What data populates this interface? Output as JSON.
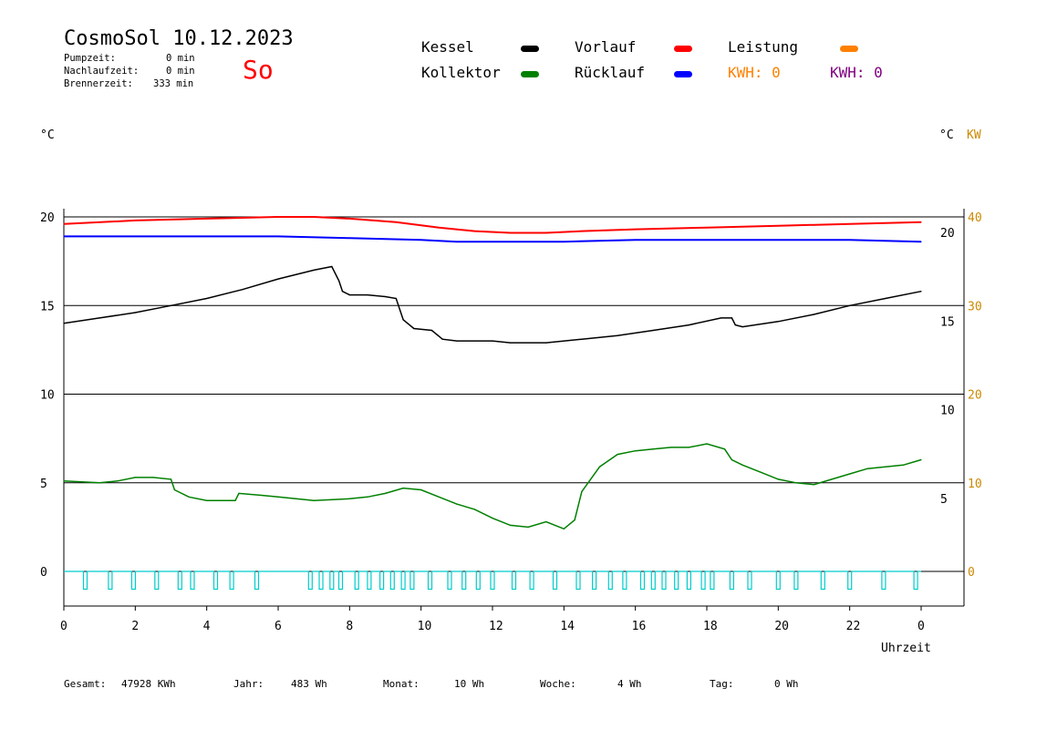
{
  "header": {
    "title": "CosmoSol 10.12.2023",
    "weekday": "So",
    "stats": [
      {
        "label": "Pumpzeit:",
        "value": "0 min"
      },
      {
        "label": "Nachlaufzeit:",
        "value": "0 min"
      },
      {
        "label": "Brennerzeit:",
        "value": "333 min"
      }
    ]
  },
  "legend": {
    "kessel": {
      "label": "Kessel",
      "color": "#000000"
    },
    "vorlauf": {
      "label": "Vorlauf",
      "color": "#ff0000"
    },
    "leistung": {
      "label": "Leistung",
      "color": "#ff8000"
    },
    "kollektor": {
      "label": "Kollektor",
      "color": "#008000"
    },
    "ruecklauf": {
      "label": "Rücklauf",
      "color": "#0000ff"
    },
    "kwh_orange": "KWH: 0",
    "kwh_purple": "KWH: 0",
    "kwh_orange_color": "#ff8000",
    "kwh_purple_color": "#800080"
  },
  "units": {
    "left": "°C",
    "right": "°C",
    "right_power": "KW"
  },
  "footer": [
    {
      "label": "Gesamt:",
      "value": "47928 KWh"
    },
    {
      "label": "Jahr:",
      "value": "483 Wh"
    },
    {
      "label": "Monat:",
      "value": "10 Wh"
    },
    {
      "label": "Woche:",
      "value": "4 Wh"
    },
    {
      "label": "Tag:",
      "value": "0 Wh"
    }
  ],
  "chart_data": {
    "type": "line",
    "xlabel": "Uhrzeit",
    "x_ticks": [
      "0",
      "2",
      "4",
      "6",
      "8",
      "10",
      "12",
      "14",
      "16",
      "18",
      "20",
      "22",
      "0"
    ],
    "xlim": [
      0,
      24
    ],
    "y_left_ticks": [
      "20",
      "15",
      "10",
      "5",
      "0"
    ],
    "y_right_inner_ticks": [
      "20",
      "15",
      "10",
      "5"
    ],
    "y_right_power_ticks": [
      "40",
      "30",
      "20",
      "10",
      "0"
    ],
    "ylim": [
      0,
      20
    ],
    "grid": "horizontal",
    "series": [
      {
        "name": "Vorlauf",
        "color": "#ff0000",
        "points": [
          [
            0,
            19.6
          ],
          [
            2,
            19.8
          ],
          [
            4,
            19.9
          ],
          [
            6,
            20.0
          ],
          [
            7,
            20.0
          ],
          [
            8,
            19.9
          ],
          [
            9.3,
            19.7
          ],
          [
            10.5,
            19.4
          ],
          [
            11.5,
            19.2
          ],
          [
            12.5,
            19.1
          ],
          [
            13.5,
            19.1
          ],
          [
            14.5,
            19.2
          ],
          [
            16,
            19.3
          ],
          [
            18,
            19.4
          ],
          [
            20,
            19.5
          ],
          [
            22,
            19.6
          ],
          [
            24,
            19.7
          ]
        ]
      },
      {
        "name": "Rücklauf",
        "color": "#0000ff",
        "points": [
          [
            0,
            18.9
          ],
          [
            2,
            18.9
          ],
          [
            4,
            18.9
          ],
          [
            6,
            18.9
          ],
          [
            8,
            18.8
          ],
          [
            10,
            18.7
          ],
          [
            11,
            18.6
          ],
          [
            12,
            18.6
          ],
          [
            13,
            18.6
          ],
          [
            14,
            18.6
          ],
          [
            16,
            18.7
          ],
          [
            18,
            18.7
          ],
          [
            20,
            18.7
          ],
          [
            22,
            18.7
          ],
          [
            24,
            18.6
          ]
        ]
      },
      {
        "name": "Kessel",
        "color": "#000000",
        "points": [
          [
            0,
            14.0
          ],
          [
            1,
            14.3
          ],
          [
            2,
            14.6
          ],
          [
            3,
            15.0
          ],
          [
            4,
            15.4
          ],
          [
            5,
            15.9
          ],
          [
            6,
            16.5
          ],
          [
            7,
            17.0
          ],
          [
            7.5,
            17.2
          ],
          [
            7.7,
            16.4
          ],
          [
            7.8,
            15.8
          ],
          [
            8,
            15.6
          ],
          [
            8.5,
            15.6
          ],
          [
            9,
            15.5
          ],
          [
            9.3,
            15.4
          ],
          [
            9.5,
            14.2
          ],
          [
            9.8,
            13.7
          ],
          [
            10.3,
            13.6
          ],
          [
            10.6,
            13.1
          ],
          [
            11,
            13.0
          ],
          [
            12,
            13.0
          ],
          [
            12.5,
            12.9
          ],
          [
            13.5,
            12.9
          ],
          [
            14.5,
            13.1
          ],
          [
            15.5,
            13.3
          ],
          [
            16.5,
            13.6
          ],
          [
            17.5,
            13.9
          ],
          [
            18.4,
            14.3
          ],
          [
            18.7,
            14.3
          ],
          [
            18.8,
            13.9
          ],
          [
            19,
            13.8
          ],
          [
            20,
            14.1
          ],
          [
            21,
            14.5
          ],
          [
            22,
            15.0
          ],
          [
            23,
            15.4
          ],
          [
            24,
            15.8
          ]
        ]
      },
      {
        "name": "Kollektor",
        "color": "#008000",
        "points": [
          [
            0,
            5.1
          ],
          [
            1,
            5.0
          ],
          [
            1.5,
            5.1
          ],
          [
            2,
            5.3
          ],
          [
            2.5,
            5.3
          ],
          [
            3,
            5.2
          ],
          [
            3.1,
            4.6
          ],
          [
            3.5,
            4.2
          ],
          [
            4,
            4.0
          ],
          [
            4.5,
            4.0
          ],
          [
            4.8,
            4.0
          ],
          [
            4.9,
            4.4
          ],
          [
            5.5,
            4.3
          ],
          [
            6,
            4.2
          ],
          [
            6.5,
            4.1
          ],
          [
            7,
            4.0
          ],
          [
            8,
            4.1
          ],
          [
            8.5,
            4.2
          ],
          [
            9,
            4.4
          ],
          [
            9.5,
            4.7
          ],
          [
            10,
            4.6
          ],
          [
            10.5,
            4.2
          ],
          [
            11,
            3.8
          ],
          [
            11.5,
            3.5
          ],
          [
            12,
            3.0
          ],
          [
            12.5,
            2.6
          ],
          [
            13,
            2.5
          ],
          [
            13.5,
            2.8
          ],
          [
            14,
            2.4
          ],
          [
            14.3,
            2.9
          ],
          [
            14.5,
            4.5
          ],
          [
            15,
            5.9
          ],
          [
            15.5,
            6.6
          ],
          [
            16,
            6.8
          ],
          [
            16.5,
            6.9
          ],
          [
            17,
            7.0
          ],
          [
            17.5,
            7.0
          ],
          [
            18,
            7.2
          ],
          [
            18.5,
            6.9
          ],
          [
            18.7,
            6.3
          ],
          [
            19,
            6.0
          ],
          [
            19.5,
            5.6
          ],
          [
            20,
            5.2
          ],
          [
            20.5,
            5.0
          ],
          [
            21,
            4.9
          ],
          [
            21.5,
            5.2
          ],
          [
            22,
            5.5
          ],
          [
            22.5,
            5.8
          ],
          [
            23,
            5.9
          ],
          [
            23.5,
            6.0
          ],
          [
            24,
            6.3
          ]
        ]
      },
      {
        "name": "Leistung",
        "color": "#00cccc",
        "baseline": 0,
        "pulse_depth": -1,
        "pulses": [
          0.6,
          1.3,
          1.95,
          2.6,
          3.25,
          3.6,
          4.25,
          4.7,
          5.4,
          6.9,
          7.2,
          7.5,
          7.75,
          8.2,
          8.55,
          8.9,
          9.2,
          9.5,
          9.75,
          10.25,
          10.8,
          11.2,
          11.6,
          12.0,
          12.6,
          13.1,
          13.75,
          14.4,
          14.85,
          15.3,
          15.7,
          16.2,
          16.5,
          16.8,
          17.15,
          17.5,
          17.9,
          18.15,
          18.7,
          19.2,
          20.0,
          20.5,
          21.25,
          22.0,
          22.95,
          23.85
        ]
      }
    ]
  }
}
